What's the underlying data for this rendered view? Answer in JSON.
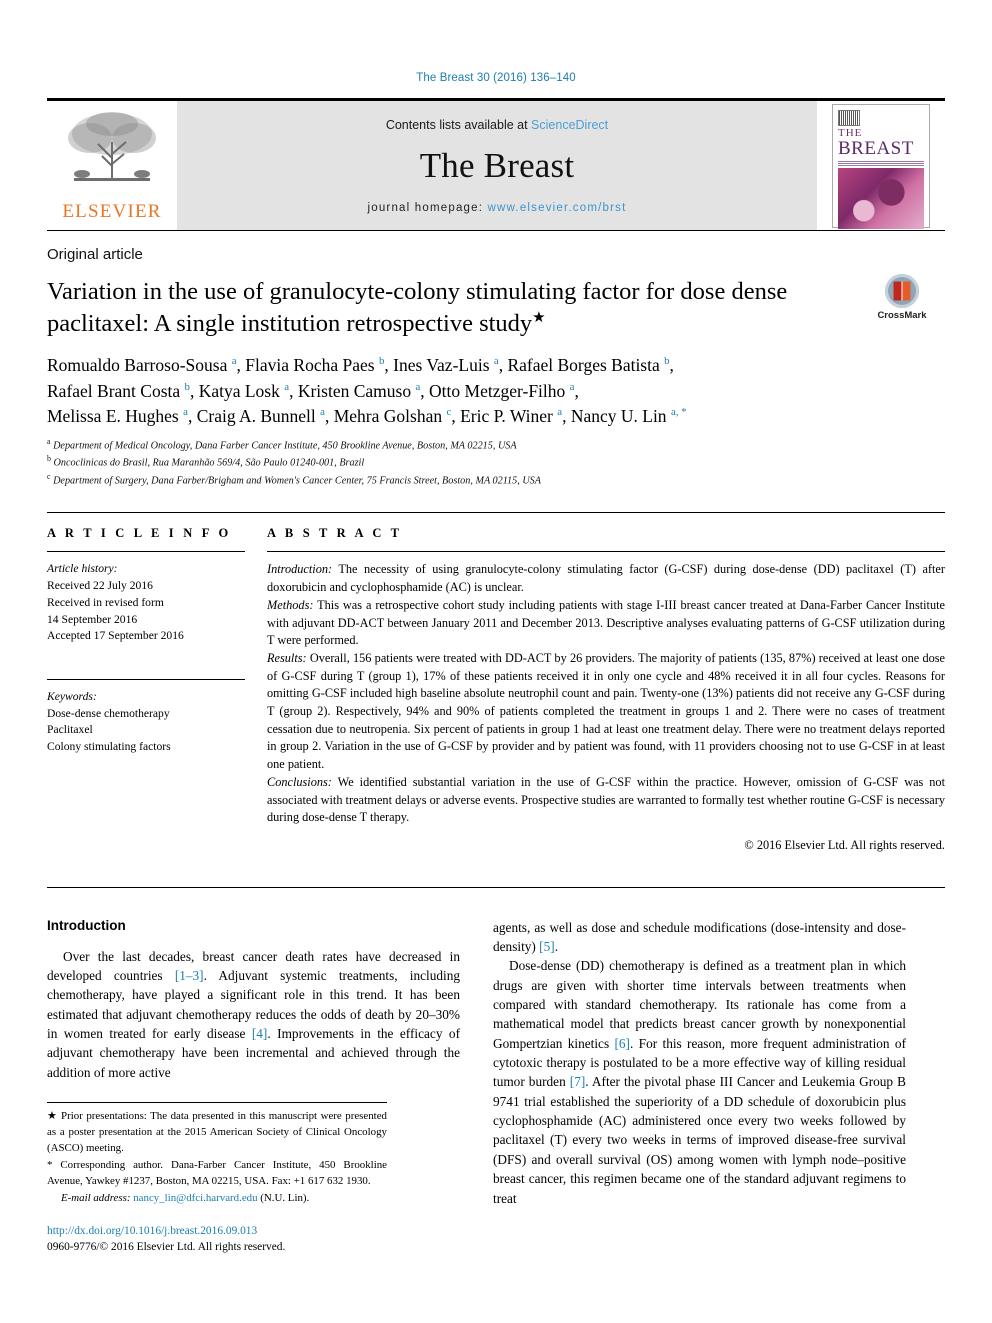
{
  "running_head": "The Breast 30 (2016) 136–140",
  "masthead": {
    "contents_prefix": "Contents lists available at ",
    "sciencedirect": "ScienceDirect",
    "journal_title": "The Breast",
    "homepage_prefix": "journal homepage: ",
    "homepage_url": "www.elsevier.com/brst",
    "publisher": "ELSEVIER",
    "cover_the": "THE",
    "cover_breast": "BREAST"
  },
  "article": {
    "type": "Original article",
    "title": "Variation in the use of granulocyte-colony stimulating factor for dose dense paclitaxel: A single institution retrospective study",
    "title_marker": "★",
    "crossmark_label": "CrossMark",
    "authors_line1": "Romualdo Barroso-Sousa a, Flavia Rocha Paes b, Ines Vaz-Luis a, Rafael Borges Batista b,",
    "authors_line2": "Rafael Brant Costa b, Katya Losk a, Kristen Camuso a, Otto Metzger-Filho a,",
    "authors_line3": "Melissa E. Hughes a, Craig A. Bunnell a, Mehra Golshan c, Eric P. Winer a, Nancy U. Lin a, *",
    "affiliations": [
      {
        "marker": "a",
        "text": "Department of Medical Oncology, Dana Farber Cancer Institute, 450 Brookline Avenue, Boston, MA 02215, USA"
      },
      {
        "marker": "b",
        "text": "Oncoclinicas do Brasil, Rua Maranhão 569/4, São Paulo 01240-001, Brazil"
      },
      {
        "marker": "c",
        "text": "Department of Surgery, Dana Farber/Brigham and Women's Cancer Center, 75 Francis Street, Boston, MA 02115, USA"
      }
    ]
  },
  "article_info": {
    "heading": "A R T I C L E    I N F O",
    "history_label": "Article history:",
    "history": [
      "Received 22 July 2016",
      "Received in revised form",
      "14 September 2016",
      "Accepted 17 September 2016"
    ],
    "keywords_label": "Keywords:",
    "keywords": [
      "Dose-dense chemotherapy",
      "Paclitaxel",
      "Colony stimulating factors"
    ]
  },
  "abstract": {
    "heading": "A B S T R A C T",
    "sections": [
      {
        "label": "Introduction:",
        "text": " The necessity of using granulocyte-colony stimulating factor (G-CSF) during dose-dense (DD) paclitaxel (T) after doxorubicin and cyclophosphamide (AC) is unclear."
      },
      {
        "label": "Methods:",
        "text": " This was a retrospective cohort study including patients with stage I-III breast cancer treated at Dana-Farber Cancer Institute with adjuvant DD-ACT between January 2011 and December 2013. Descriptive analyses evaluating patterns of G-CSF utilization during T were performed."
      },
      {
        "label": "Results:",
        "text": " Overall, 156 patients were treated with DD-ACT by 26 providers. The majority of patients (135, 87%) received at least one dose of G-CSF during T (group 1), 17% of these patients received it in only one cycle and 48% received it in all four cycles. Reasons for omitting G-CSF included high baseline absolute neutrophil count and pain. Twenty-one (13%) patients did not receive any G-CSF during T (group 2). Respectively, 94% and 90% of patients completed the treatment in groups 1 and 2. There were no cases of treatment cessation due to neutropenia. Six percent of patients in group 1 had at least one treatment delay. There were no treatment delays reported in group 2. Variation in the use of G-CSF by provider and by patient was found, with 11 providers choosing not to use G-CSF in at least one patient."
      },
      {
        "label": "Conclusions:",
        "text": " We identified substantial variation in the use of G-CSF within the practice. However, omission of G-CSF was not associated with treatment delays or adverse events. Prospective studies are warranted to formally test whether routine G-CSF is necessary during dose-dense T therapy."
      }
    ],
    "copyright": "© 2016 Elsevier Ltd. All rights reserved."
  },
  "body": {
    "intro_heading": "Introduction",
    "left_paragraph": "Over the last decades, breast cancer death rates have decreased in developed countries [1–3]. Adjuvant systemic treatments, including chemotherapy, have played a significant role in this trend. It has been estimated that adjuvant chemotherapy reduces the odds of death by 20–30% in women treated for early disease [4]. Improvements in the efficacy of adjuvant chemotherapy have been incremental and achieved through the addition of more active",
    "right_paragraph_1": "agents, as well as dose and schedule modifications (dose-intensity and dose-density) [5].",
    "right_paragraph_2": "Dose-dense (DD) chemotherapy is defined as a treatment plan in which drugs are given with shorter time intervals between treatments when compared with standard chemotherapy. Its rationale has come from a mathematical model that predicts breast cancer growth by nonexponential Gompertzian kinetics [6]. For this reason, more frequent administration of cytotoxic therapy is postulated to be a more effective way of killing residual tumor burden [7]. After the pivotal phase III Cancer and Leukemia Group B 9741 trial established the superiority of a DD schedule of doxorubicin plus cyclophosphamide (AC) administered once every two weeks followed by paclitaxel (T) every two weeks in terms of improved disease-free survival (DFS) and overall survival (OS) among women with lymph node–positive breast cancer, this regimen became one of the standard adjuvant regimens to treat"
  },
  "footnotes": {
    "prior_presentations": "★ Prior presentations: The data presented in this manuscript were presented as a poster presentation at the 2015 American Society of Clinical Oncology (ASCO) meeting.",
    "corresponding_author": "* Corresponding author. Dana-Farber Cancer Institute, 450 Brookline Avenue, Yawkey #1237, Boston, MA 02215, USA. Fax: +1 617 632 1930.",
    "email_label": "E-mail address:",
    "email": "nancy_lin@dfci.harvard.edu",
    "email_suffix": " (N.U. Lin).",
    "doi": "http://dx.doi.org/10.1016/j.breast.2016.09.013",
    "issn_line": "0960-9776/© 2016 Elsevier Ltd. All rights reserved."
  }
}
